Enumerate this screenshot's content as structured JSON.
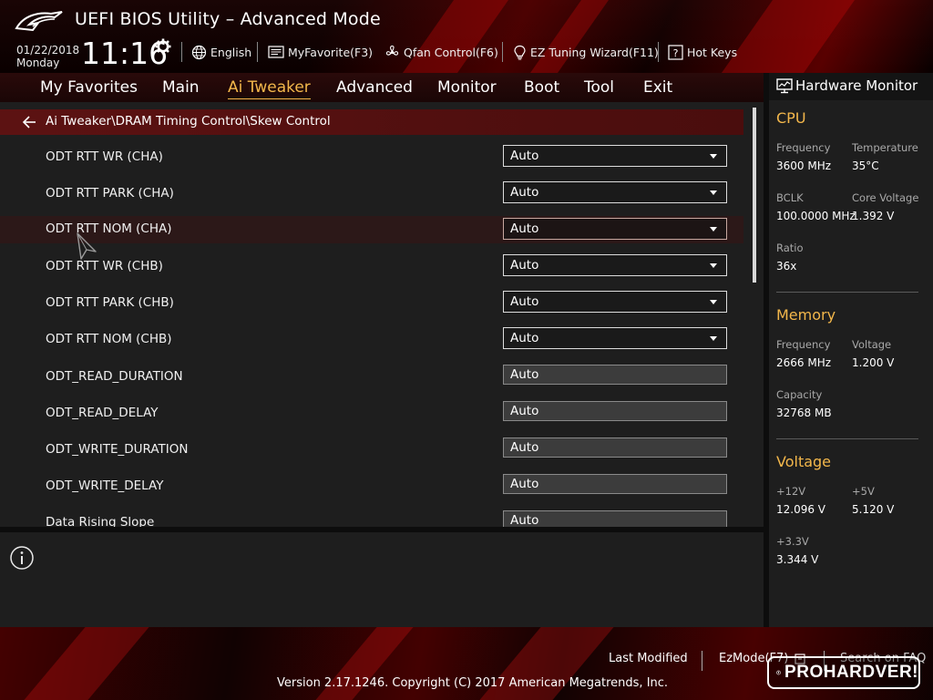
{
  "header": {
    "title": "UEFI BIOS Utility – Advanced Mode",
    "date": "01/22/2018",
    "day": "Monday",
    "time": "11:16",
    "language": "English",
    "myfavorite": "MyFavorite(F3)",
    "qfan": "Qfan Control(F6)",
    "ez_tuning": "EZ Tuning Wizard(F11)",
    "hotkeys": "Hot Keys",
    "hotkeys_icon_glyph": "?"
  },
  "menu": {
    "tabs": [
      "My Favorites",
      "Main",
      "Ai Tweaker",
      "Advanced",
      "Monitor",
      "Boot",
      "Tool",
      "Exit"
    ],
    "active": "Ai Tweaker"
  },
  "breadcrumb": "Ai Tweaker\\DRAM Timing Control\\Skew Control",
  "settings": [
    {
      "label": "ODT RTT WR (CHA)",
      "value": "Auto",
      "kind": "dropdown"
    },
    {
      "label": "ODT RTT PARK (CHA)",
      "value": "Auto",
      "kind": "dropdown"
    },
    {
      "label": "ODT RTT NOM (CHA)",
      "value": "Auto",
      "kind": "dropdown",
      "highlighted": true
    },
    {
      "label": "ODT RTT WR (CHB)",
      "value": "Auto",
      "kind": "dropdown"
    },
    {
      "label": "ODT RTT PARK (CHB)",
      "value": "Auto",
      "kind": "dropdown"
    },
    {
      "label": "ODT RTT NOM (CHB)",
      "value": "Auto",
      "kind": "dropdown"
    },
    {
      "label": "ODT_READ_DURATION",
      "value": "Auto",
      "kind": "input"
    },
    {
      "label": "ODT_READ_DELAY",
      "value": "Auto",
      "kind": "input"
    },
    {
      "label": "ODT_WRITE_DURATION",
      "value": "Auto",
      "kind": "input"
    },
    {
      "label": "ODT_WRITE_DELAY",
      "value": "Auto",
      "kind": "input"
    },
    {
      "label": "Data Rising Slope",
      "value": "Auto",
      "kind": "input"
    }
  ],
  "hardware_monitor": {
    "title": "Hardware Monitor",
    "cpu": {
      "section": "CPU",
      "frequency_label": "Frequency",
      "frequency": "3600 MHz",
      "temperature_label": "Temperature",
      "temperature": "35°C",
      "bclk_label": "BCLK",
      "bclk": "100.0000 MHz",
      "core_voltage_label": "Core Voltage",
      "core_voltage": "1.392 V",
      "ratio_label": "Ratio",
      "ratio": "36x"
    },
    "memory": {
      "section": "Memory",
      "frequency_label": "Frequency",
      "frequency": "2666 MHz",
      "voltage_label": "Voltage",
      "voltage": "1.200 V",
      "capacity_label": "Capacity",
      "capacity": "32768 MB"
    },
    "voltage": {
      "section": "Voltage",
      "v12_label": "+12V",
      "v12": "12.096 V",
      "v5_label": "+5V",
      "v5": "5.120 V",
      "v33_label": "+3.3V",
      "v33": "3.344 V"
    }
  },
  "footer": {
    "last_modified": "Last Modified",
    "ezmode": "EzMode(F7)",
    "search": "Search on FAQ",
    "version": "Version 2.17.1246. Copyright (C) 2017 American Megatrends, Inc."
  },
  "watermark": "PROHARDVER!",
  "colors": {
    "accent": "#f3b74b",
    "breadcrumb_bg": "#5c1212",
    "panel_bg": "#1e1e1e"
  },
  "icons": {
    "language": "globe-icon",
    "myfavorite": "keyboard-icon",
    "qfan": "fan-icon",
    "ez_tuning": "lightbulb-icon",
    "hotkeys": "question-box-icon",
    "clock_settings": "gear-icon",
    "back": "back-arrow-icon",
    "help": "info-icon",
    "monitor": "monitor-icon"
  }
}
